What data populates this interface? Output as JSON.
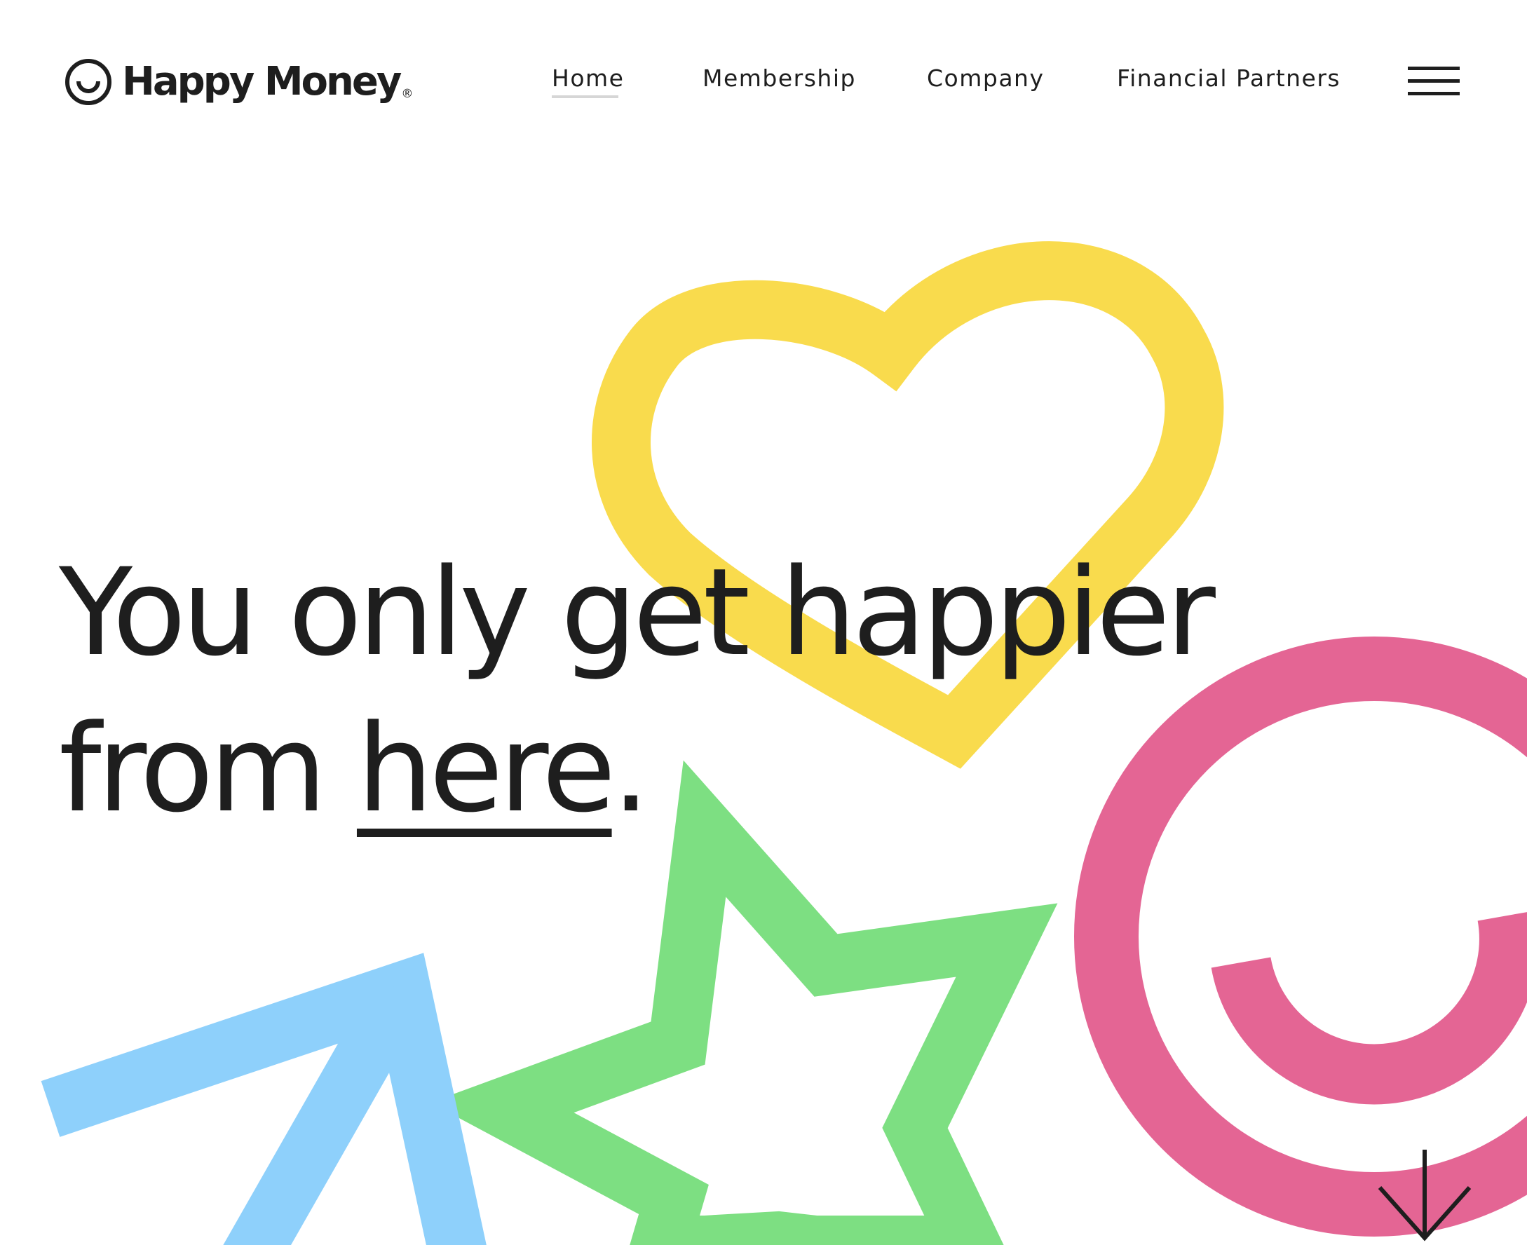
{
  "brand": {
    "name": "Happy Money",
    "registered_mark": "®"
  },
  "nav": {
    "items": [
      {
        "label": "Home",
        "active": true
      },
      {
        "label": "Membership",
        "active": false
      },
      {
        "label": "Company",
        "active": false
      },
      {
        "label": "Financial Partners",
        "active": false
      }
    ],
    "menu_icon": "hamburger-menu-icon"
  },
  "hero": {
    "line1": "You only get happier",
    "line2_prefix": "from ",
    "line2_link": "here",
    "line2_suffix": "."
  },
  "scroll": {
    "icon": "arrow-down-icon"
  },
  "decorations": {
    "heart": {
      "icon": "heart-shape",
      "color": "#f9db4d"
    },
    "smile": {
      "icon": "smile-circle-shape",
      "color": "#e46594"
    },
    "star": {
      "icon": "star-shape",
      "color": "#7ddf82"
    },
    "arrow": {
      "icon": "arrow-up-right-shape",
      "color": "#8ed0fb"
    }
  },
  "colors": {
    "text": "#1e1e1e",
    "background": "#ffffff",
    "nav_active_underline": "#d6d6d6"
  }
}
